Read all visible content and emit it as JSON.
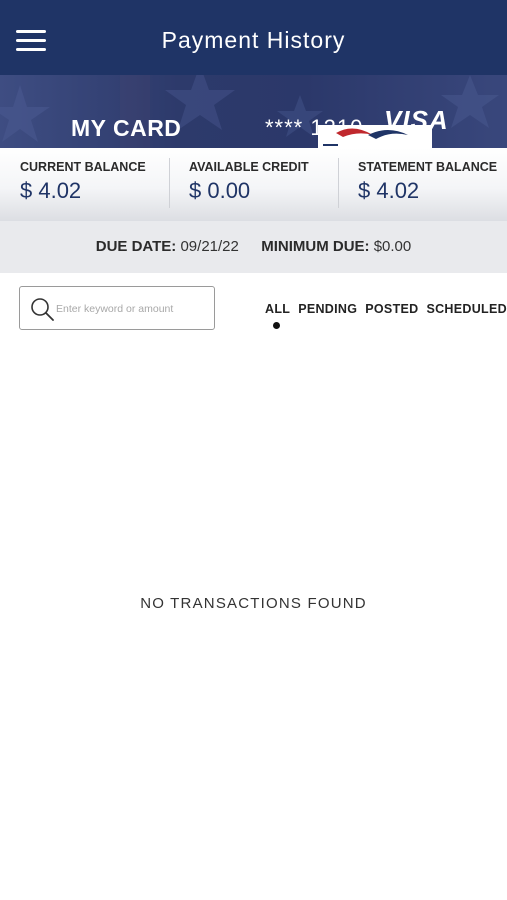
{
  "header": {
    "title": "Payment History",
    "menu_icon": "hamburger-menu-icon",
    "background_color": "#1f3466"
  },
  "card": {
    "name": "MY CARD",
    "number_masked": "**** 1210",
    "network": "VISA"
  },
  "balances": [
    {
      "label": "CURRENT BALANCE",
      "value": "$ 4.02"
    },
    {
      "label": "AVAILABLE CREDIT",
      "value": "$ 0.00"
    },
    {
      "label": "STATEMENT BALANCE",
      "value": "$ 4.02"
    }
  ],
  "due": {
    "date_label": "DUE DATE:",
    "date_value": "09/21/22",
    "minimum_label": "MINIMUM DUE:",
    "minimum_value": "$0.00"
  },
  "search": {
    "placeholder": "Enter keyword or amount",
    "value": "",
    "icon": "search-icon"
  },
  "filters": {
    "tabs": [
      "ALL",
      "PENDING",
      "POSTED",
      "SCHEDULED"
    ],
    "selected": "ALL"
  },
  "transactions": {
    "empty_message": "NO TRANSACTIONS FOUND"
  }
}
